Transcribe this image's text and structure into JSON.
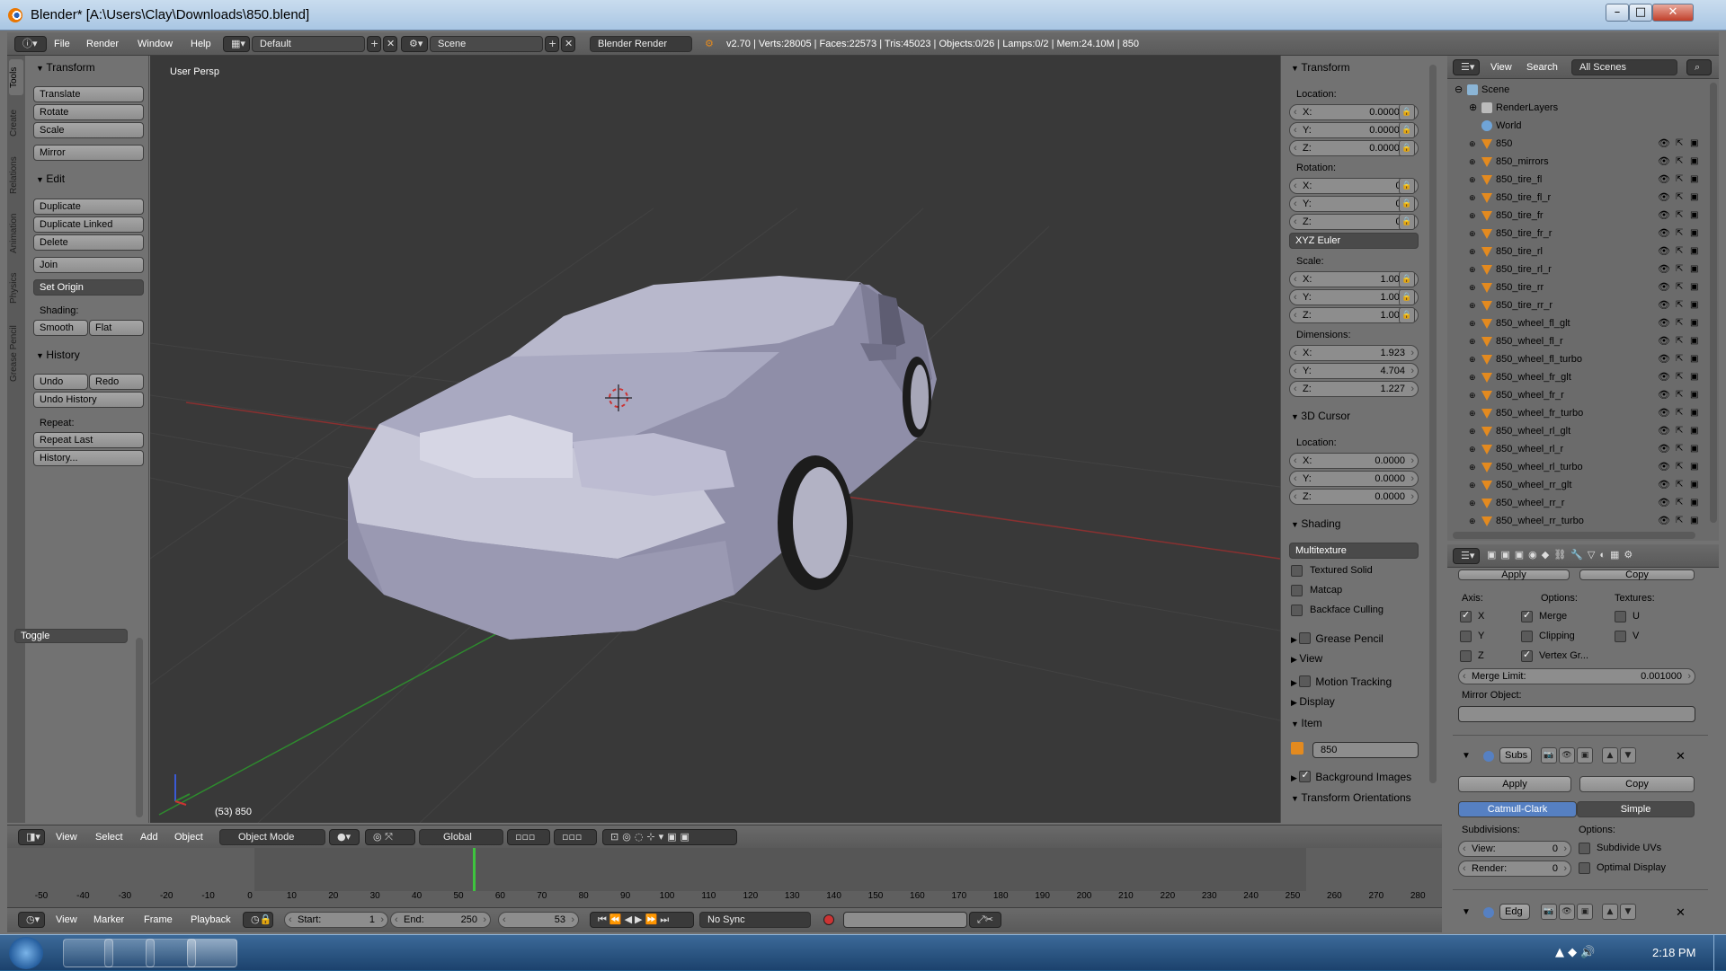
{
  "window": {
    "title": "Blender* [A:\\Users\\Clay\\Downloads\\850.blend]",
    "minimize": "–",
    "maximize": "□",
    "close": "✕"
  },
  "menubar": {
    "items": [
      "File",
      "Render",
      "Window",
      "Help"
    ],
    "layout": "Default",
    "scene": "Scene",
    "engine": "Blender Render",
    "stats": "v2.70 | Verts:28005 | Faces:22573 | Tris:45023 | Objects:0/26 | Lamps:0/2 | Mem:24.10M | 850"
  },
  "toolshelf": {
    "tabs": [
      "Tools",
      "Create",
      "Relations",
      "Animation",
      "Physics",
      "Grease Pencil"
    ],
    "transform": {
      "header": "Transform",
      "buttons": [
        "Translate",
        "Rotate",
        "Scale",
        "Mirror"
      ]
    },
    "edit": {
      "header": "Edit",
      "buttons": [
        "Duplicate",
        "Duplicate Linked",
        "Delete",
        "Join"
      ],
      "set_origin": "Set Origin",
      "shading_label": "Shading:",
      "smooth": "Smooth",
      "flat": "Flat"
    },
    "history": {
      "header": "History",
      "undo": "Undo",
      "redo": "Redo",
      "undo_history": "Undo History",
      "repeat_label": "Repeat:",
      "repeat_last": "Repeat Last",
      "history": "History..."
    },
    "toggle": "Toggle"
  },
  "viewport": {
    "label": "User Persp",
    "frame_info": "(53) 850"
  },
  "npanel": {
    "transform": {
      "header": "Transform",
      "location_label": "Location:",
      "loc": [
        [
          "X:",
          "0.00000"
        ],
        [
          "Y:",
          "0.00000"
        ],
        [
          "Z:",
          "0.00000"
        ]
      ],
      "rotation_label": "Rotation:",
      "rot": [
        [
          "X:",
          "0°"
        ],
        [
          "Y:",
          "0°"
        ],
        [
          "Z:",
          "0°"
        ]
      ],
      "rot_mode": "XYZ Euler",
      "scale_label": "Scale:",
      "scale": [
        [
          "X:",
          "1.000"
        ],
        [
          "Y:",
          "1.000"
        ],
        [
          "Z:",
          "1.000"
        ]
      ],
      "dim_label": "Dimensions:",
      "dim": [
        [
          "X:",
          "1.923"
        ],
        [
          "Y:",
          "4.704"
        ],
        [
          "Z:",
          "1.227"
        ]
      ]
    },
    "cursor": {
      "header": "3D Cursor",
      "location_label": "Location:",
      "loc": [
        [
          "X:",
          "0.0000"
        ],
        [
          "Y:",
          "0.0000"
        ],
        [
          "Z:",
          "0.0000"
        ]
      ]
    },
    "shading": {
      "header": "Shading",
      "mode": "Multitexture",
      "opts": [
        "Textured Solid",
        "Matcap",
        "Backface Culling"
      ]
    },
    "collapsed": [
      "Grease Pencil",
      "View",
      "Motion Tracking",
      "Display"
    ],
    "item": {
      "header": "Item",
      "name": "850"
    },
    "bg_images": "Background Images",
    "transform_orient": "Transform Orientations"
  },
  "outliner": {
    "view": "View",
    "search": "Search",
    "scenes": "All Scenes",
    "tree": [
      "Scene",
      "RenderLayers",
      "World"
    ],
    "objects": [
      "850",
      "850_mirrors",
      "850_tire_fl",
      "850_tire_fl_r",
      "850_tire_fr",
      "850_tire_fr_r",
      "850_tire_rl",
      "850_tire_rl_r",
      "850_tire_rr",
      "850_tire_rr_r",
      "850_wheel_fl_glt",
      "850_wheel_fl_r",
      "850_wheel_fl_turbo",
      "850_wheel_fr_glt",
      "850_wheel_fr_r",
      "850_wheel_fr_turbo",
      "850_wheel_rl_glt",
      "850_wheel_rl_r",
      "850_wheel_rl_turbo",
      "850_wheel_rr_glt",
      "850_wheel_rr_r",
      "850_wheel_rr_turbo"
    ]
  },
  "properties": {
    "mirror": {
      "apply": "Apply",
      "copy": "Copy",
      "axis_label": "Axis:",
      "options_label": "Options:",
      "textures_label": "Textures:",
      "axis": [
        "X",
        "Y",
        "Z"
      ],
      "options": [
        "Merge",
        "Clipping",
        "Vertex Gr..."
      ],
      "textures": [
        "U",
        "V"
      ],
      "merge_limit_label": "Merge Limit:",
      "merge_limit": "0.001000",
      "mirror_object_label": "Mirror Object:"
    },
    "subsurf": {
      "name": "Subs",
      "apply": "Apply",
      "copy": "Copy",
      "catmull": "Catmull-Clark",
      "simple": "Simple",
      "subdiv_label": "Subdivisions:",
      "options_label": "Options:",
      "view_label": "View:",
      "view_val": "0",
      "render_label": "Render:",
      "render_val": "0",
      "opt1": "Subdivide UVs",
      "opt2": "Optimal Display"
    },
    "edge": {
      "name": "Edg"
    }
  },
  "viewheader": {
    "items": [
      "View",
      "Select",
      "Add",
      "Object"
    ],
    "mode": "Object Mode",
    "orientation": "Global"
  },
  "timeline": {
    "ticks": [
      "-50",
      "-40",
      "-30",
      "-20",
      "-10",
      "0",
      "10",
      "20",
      "30",
      "40",
      "50",
      "60",
      "70",
      "80",
      "90",
      "100",
      "110",
      "120",
      "130",
      "140",
      "150",
      "160",
      "170",
      "180",
      "190",
      "200",
      "210",
      "220",
      "230",
      "240",
      "250",
      "260",
      "270",
      "280"
    ],
    "menu": [
      "View",
      "Marker",
      "Frame",
      "Playback"
    ],
    "start_label": "Start:",
    "start": "1",
    "end_label": "End:",
    "end": "250",
    "current": "53",
    "sync": "No Sync"
  },
  "taskbar": {
    "time": "2:18 PM"
  },
  "colors": {
    "accent": "#5680c2",
    "viewport": "#393939",
    "panel": "#727272",
    "cursor_line": "#2e8a2e",
    "playhead": "#3ec43e"
  }
}
